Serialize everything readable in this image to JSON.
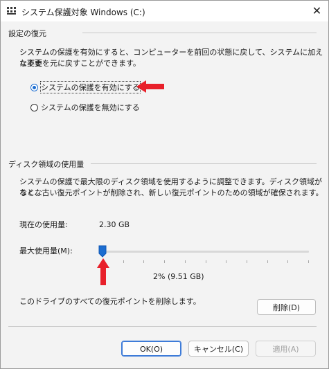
{
  "window": {
    "title": "システム保護対象 Windows (C:)",
    "close_glyph": "✕"
  },
  "restore": {
    "group_title": "設定の復元",
    "description_line1": "システムの保護を有効にすると、コンピューターを前回の状態に戻して、システムに加えた不要",
    "description_line2": "な変更を元に戻すことができます。",
    "options": [
      {
        "label": "システムの保護を有効にする",
        "checked": true
      },
      {
        "label": "システムの保護を無効にする",
        "checked": false
      }
    ]
  },
  "disk": {
    "group_title": "ディスク領域の使用量",
    "description_line1": "システムの保護で最大限のディスク領域を使用するように調整できます。ディスク領域がなくな",
    "description_line2": "ると、古い復元ポイントが削除され、新しい復元ポイントのための領域が確保されます。",
    "current_usage_label": "現在の使用量:",
    "current_usage_value": "2.30 GB",
    "max_usage_label": "最大使用量(M):",
    "max_usage_level_percent": 2,
    "slider_value_text": "2% (9.51 GB)",
    "delete_description": "このドライブのすべての復元ポイントを削除します。",
    "delete_button": "削除(D)"
  },
  "footer": {
    "ok_button": "OK(O)",
    "cancel_button": "キャンセル(C)",
    "apply_button": "適用(A)"
  },
  "colors": {
    "accent": "#1c6dd0",
    "annotation_arrow": "#e8202a"
  },
  "icons": {
    "app": "system-properties-icon",
    "close": "close-icon",
    "annotation": "red-arrow-icon"
  }
}
